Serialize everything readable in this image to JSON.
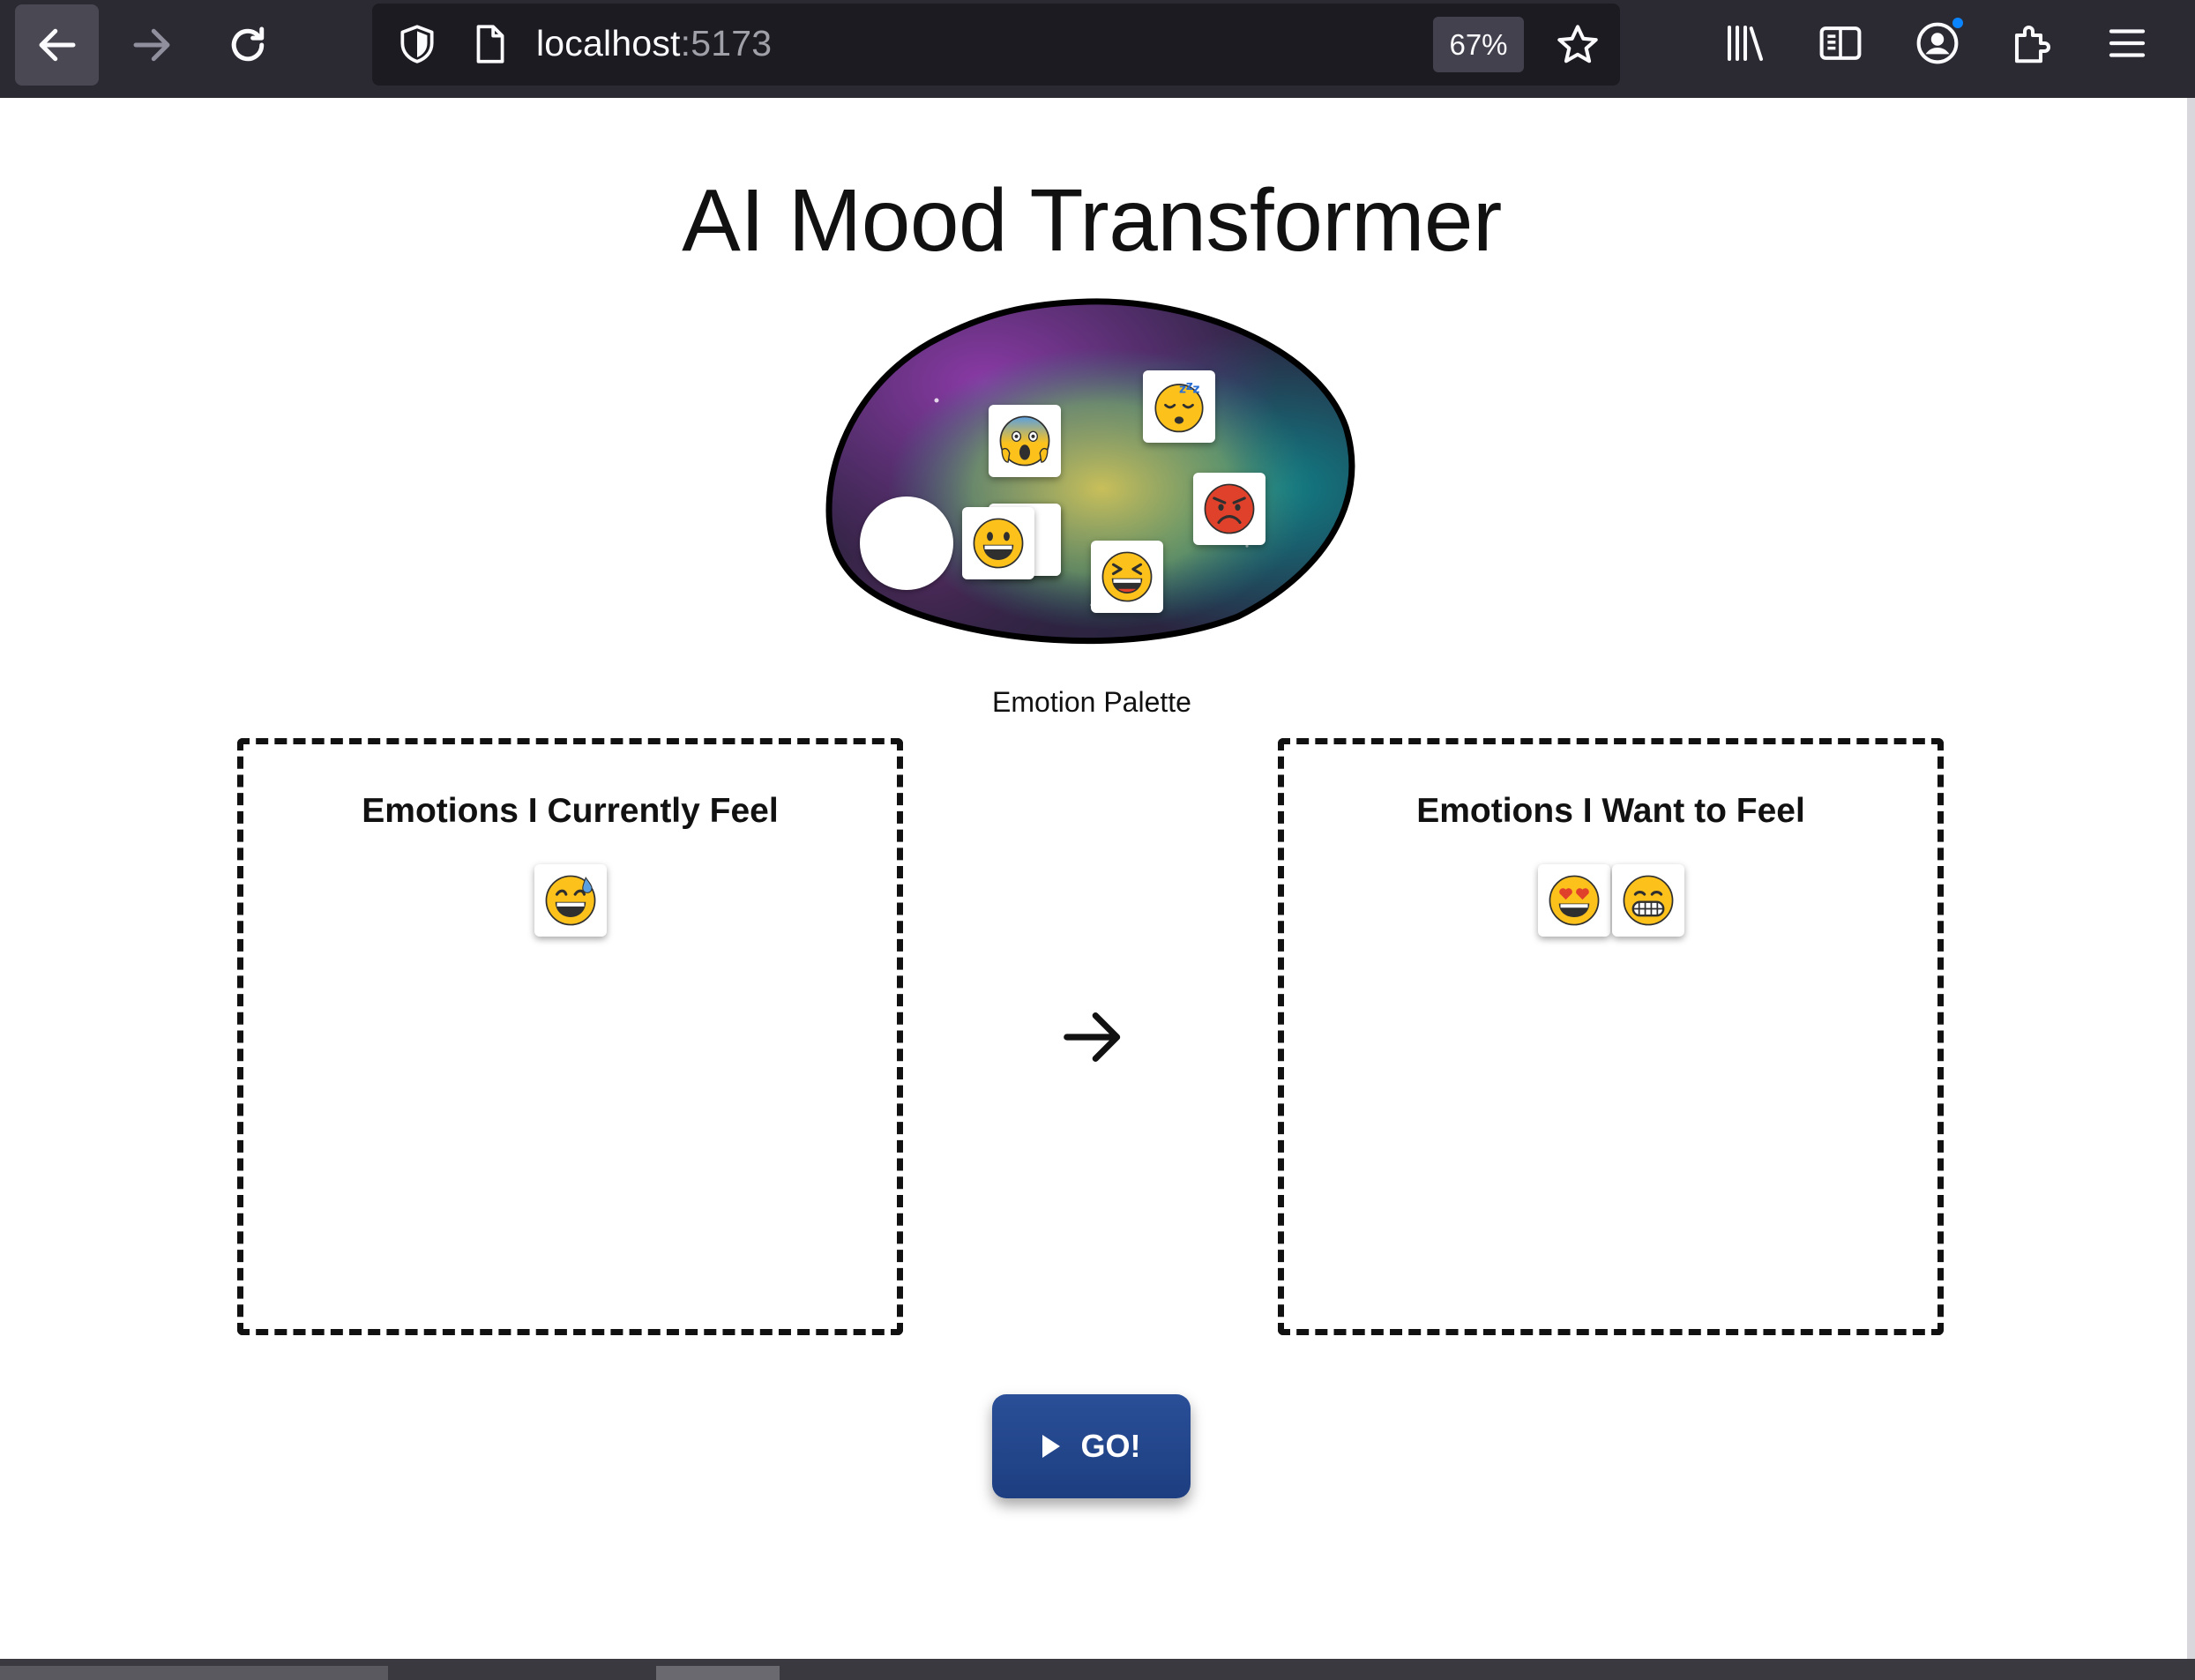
{
  "browser": {
    "url_host": "localhost",
    "url_port": ":5173",
    "zoom": "67%",
    "icons": [
      "back-arrow-icon",
      "forward-arrow-icon",
      "reload-icon",
      "shield-icon",
      "page-icon",
      "star-icon",
      "library-icon",
      "reader-view-icon",
      "account-icon",
      "extensions-icon",
      "menu-icon"
    ]
  },
  "page": {
    "title": "AI Mood Transformer",
    "palette_label": "Emotion Palette",
    "palette_emojis": [
      "fearful-scream",
      "sleeping",
      "angry-red",
      "grinning",
      "laughing-squint"
    ],
    "current": {
      "heading": "Emotions I Currently Feel",
      "emojis": [
        "grinning-sweat"
      ]
    },
    "desired": {
      "heading": "Emotions I Want to Feel",
      "emojis": [
        "heart-eyes",
        "grimacing-grin"
      ]
    },
    "arrow_icon": "right-arrow-icon",
    "go_label": "GO!"
  }
}
